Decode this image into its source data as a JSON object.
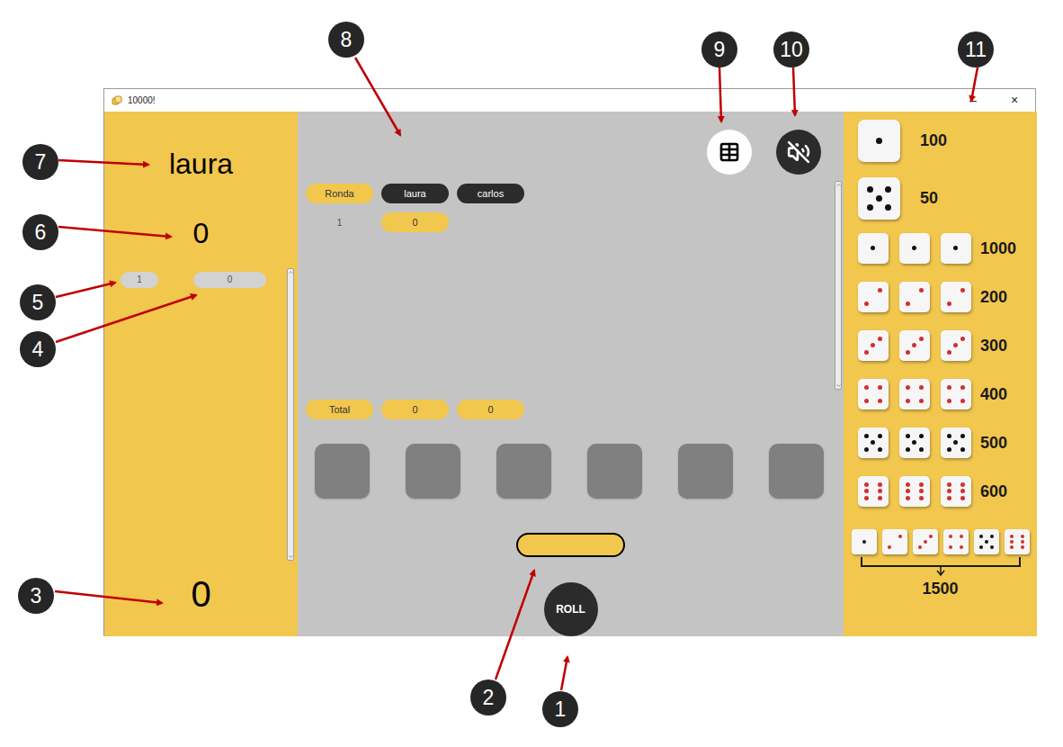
{
  "window": {
    "title": "10000!",
    "controls": [
      "–",
      "×"
    ]
  },
  "callouts": [
    {
      "number": "1"
    },
    {
      "number": "2"
    },
    {
      "number": "3"
    },
    {
      "number": "4"
    },
    {
      "number": "5"
    },
    {
      "number": "6"
    },
    {
      "number": "7"
    },
    {
      "number": "8"
    },
    {
      "number": "9"
    },
    {
      "number": "10"
    },
    {
      "number": "11"
    }
  ],
  "player": {
    "name": "laura",
    "round_score": "0",
    "total": "0"
  },
  "player_rounds": [
    {
      "round": "1",
      "score": "0"
    }
  ],
  "scoreboard": {
    "columns": [
      {
        "label": "Ronda",
        "kind": "round"
      },
      {
        "label": "laura",
        "kind": "player"
      },
      {
        "label": "carlos",
        "kind": "player"
      }
    ],
    "rows": [
      {
        "round": "1",
        "scores": [
          "0"
        ]
      }
    ],
    "totals": {
      "label": "Total",
      "values": [
        "0",
        "0"
      ]
    }
  },
  "dice_slots": [
    {
      "empty": true
    },
    {
      "empty": true
    },
    {
      "empty": true
    },
    {
      "empty": true
    },
    {
      "empty": true
    },
    {
      "empty": true
    }
  ],
  "turn_points": {
    "value": ""
  },
  "roll_button": {
    "label": "ROLL"
  },
  "sound": {
    "muted": true
  },
  "scoring": [
    {
      "kind": "single",
      "faces": [
        1
      ],
      "points": "100"
    },
    {
      "kind": "single",
      "faces": [
        5
      ],
      "points": "50"
    },
    {
      "kind": "triple",
      "faces": [
        1,
        1,
        1
      ],
      "points": "1000"
    },
    {
      "kind": "triple",
      "faces": [
        2,
        2,
        2
      ],
      "points": "200"
    },
    {
      "kind": "triple",
      "faces": [
        3,
        3,
        3
      ],
      "points": "300"
    },
    {
      "kind": "triple",
      "faces": [
        4,
        4,
        4
      ],
      "points": "400"
    },
    {
      "kind": "triple",
      "faces": [
        5,
        5,
        5
      ],
      "points": "500"
    },
    {
      "kind": "triple",
      "faces": [
        6,
        6,
        6
      ],
      "points": "600"
    },
    {
      "kind": "straight",
      "faces": [
        1,
        2,
        3,
        4,
        5,
        6
      ],
      "points": "1500"
    }
  ]
}
